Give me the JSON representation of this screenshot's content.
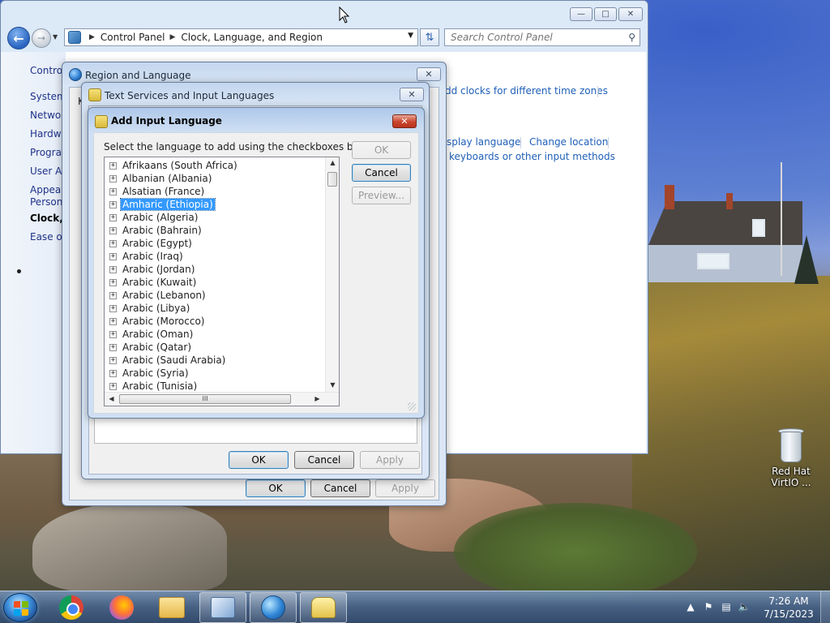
{
  "control_panel": {
    "breadcrumb": [
      "Control Panel",
      "Clock, Language, and Region"
    ],
    "search_placeholder": "Search Control Panel",
    "sidebar": {
      "home": "Control Panel Home",
      "items": [
        "System and Security",
        "Network and Internet",
        "Hardware and Sound",
        "Programs",
        "User Accounts and Family Safety",
        "Appearance and Personalization",
        "Clock, Language, and Region",
        "Ease of Access"
      ],
      "visible_fragments": [
        "Contro",
        "System",
        "Networ",
        "Hardwa",
        "Progra",
        "User Ac",
        "Appear",
        "Persona",
        "Clock, I",
        "Ease of"
      ]
    },
    "links": {
      "add_clocks": "dd clocks for different time zones",
      "display_language": "splay language",
      "change_location": "Change location",
      "keyboards": "keyboards or other input methods"
    }
  },
  "region_dialog": {
    "title": "Region and Language",
    "tab_fragment": "K",
    "ok": "OK",
    "cancel": "Cancel",
    "apply": "Apply"
  },
  "text_services_dialog": {
    "title": "Text Services and Input Languages",
    "ok": "OK",
    "cancel": "Cancel",
    "apply": "Apply"
  },
  "add_input_dialog": {
    "title": "Add Input Language",
    "instruction": "Select the language to add using the checkboxes below.",
    "ok": "OK",
    "cancel": "Cancel",
    "preview": "Preview...",
    "selected_index": 3,
    "languages": [
      "Afrikaans (South Africa)",
      "Albanian (Albania)",
      "Alsatian (France)",
      "Amharic (Ethiopia)",
      "Arabic (Algeria)",
      "Arabic (Bahrain)",
      "Arabic (Egypt)",
      "Arabic (Iraq)",
      "Arabic (Jordan)",
      "Arabic (Kuwait)",
      "Arabic (Lebanon)",
      "Arabic (Libya)",
      "Arabic (Morocco)",
      "Arabic (Oman)",
      "Arabic (Qatar)",
      "Arabic (Saudi Arabia)",
      "Arabic (Syria)",
      "Arabic (Tunisia)"
    ],
    "hscroll_thumb_glyph": "III"
  },
  "desktop": {
    "recycle_bin_label_line1": "Red Hat",
    "recycle_bin_label_line2": "VirtIO ..."
  },
  "taskbar": {
    "pinned": [
      "Google Chrome",
      "Firefox",
      "Windows Explorer",
      "Control Panel",
      "Region and Language",
      "Text Services and Input Languages"
    ],
    "clock_time": "7:26 AM",
    "clock_date": "7/15/2023"
  },
  "colors": {
    "link_blue": "#1f5fb8",
    "selection_blue": "#3399ff",
    "close_red": "#c9452d"
  }
}
